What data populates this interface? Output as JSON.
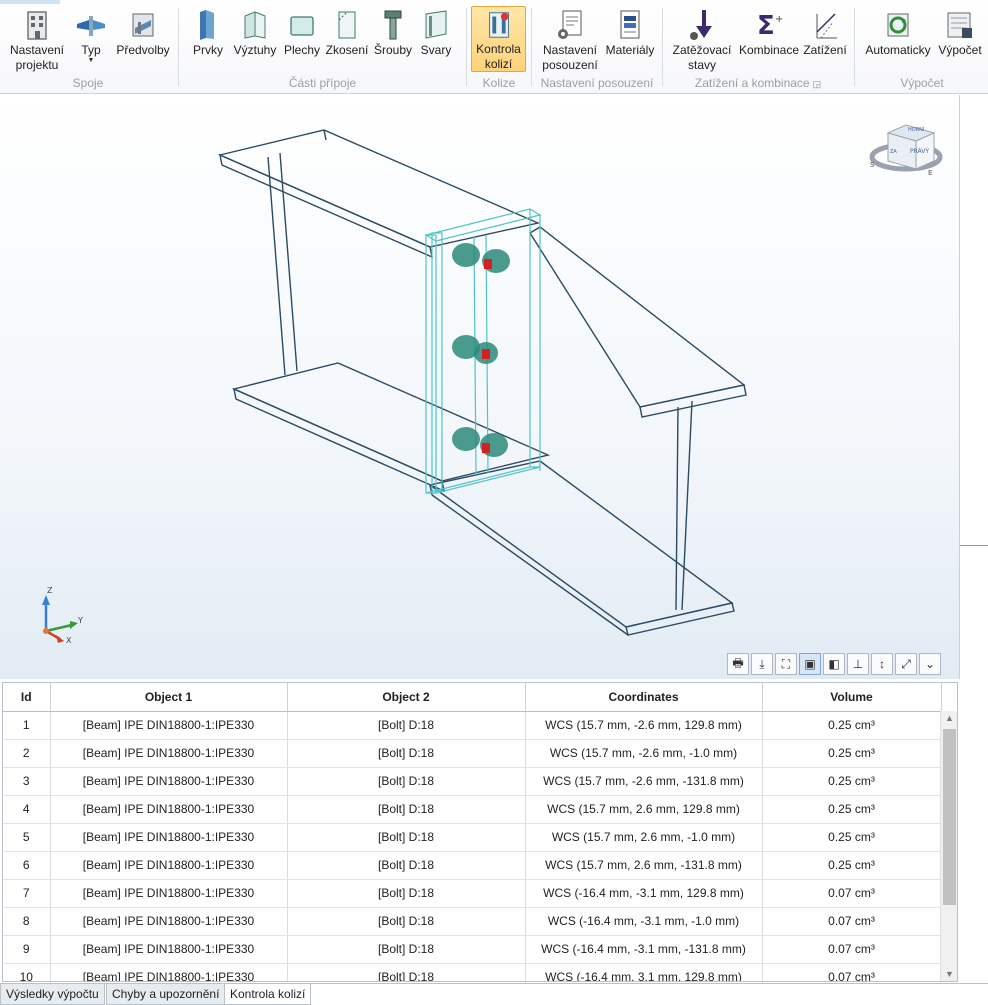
{
  "ribbon": {
    "groups": {
      "spoje": "Spoje",
      "casti": "Části přípoje",
      "kolize": "Kolize",
      "nastaveni": "Nastavení posouzení",
      "zatizeni": "Zatížení a kombinace",
      "vypocet": "Výpočet"
    },
    "buttons": {
      "nastaveni_projektu": [
        "Nastavení",
        "projektu"
      ],
      "typ": "Typ",
      "predvolby": "Předvolby",
      "prvky": "Prvky",
      "vyztuhy": "Výztuhy",
      "plechy": "Plechy",
      "zkoseni": "Zkosení",
      "srouby": "Šrouby",
      "svary": "Svary",
      "kontrola_kolizi": [
        "Kontrola",
        "kolizí"
      ],
      "nastaveni_posouzeni": [
        "Nastavení",
        "posouzení"
      ],
      "materialy": "Materiály",
      "zatezovaci_stavy": [
        "Zatěžovací",
        "stavy"
      ],
      "kombinace": "Kombinace",
      "zatizeni": "Zatížení",
      "automaticky": "Automaticky",
      "vypocet": "Výpočet"
    }
  },
  "viewport": {
    "axis_labels": {
      "z": "Z",
      "y": "Y",
      "x": "X"
    },
    "cube_label": "PRAVÝ",
    "cube_top": "HORNÍ",
    "cube_front": "ZA",
    "compass": {
      "s": "S",
      "e": "E"
    }
  },
  "table": {
    "columns": [
      "Id",
      "Object 1",
      "Object 2",
      "Coordinates",
      "Volume"
    ],
    "rows": [
      [
        "1",
        "[Beam] IPE  DIN18800-1:IPE330",
        "[Bolt] D:18",
        "WCS (15.7 mm, -2.6 mm, 129.8 mm)",
        "0.25 cm³"
      ],
      [
        "2",
        "[Beam] IPE  DIN18800-1:IPE330",
        "[Bolt] D:18",
        "WCS (15.7 mm, -2.6 mm, -1.0 mm)",
        "0.25 cm³"
      ],
      [
        "3",
        "[Beam] IPE  DIN18800-1:IPE330",
        "[Bolt] D:18",
        "WCS (15.7 mm, -2.6 mm, -131.8 mm)",
        "0.25 cm³"
      ],
      [
        "4",
        "[Beam] IPE  DIN18800-1:IPE330",
        "[Bolt] D:18",
        "WCS (15.7 mm, 2.6 mm, 129.8 mm)",
        "0.25 cm³"
      ],
      [
        "5",
        "[Beam] IPE  DIN18800-1:IPE330",
        "[Bolt] D:18",
        "WCS (15.7 mm, 2.6 mm, -1.0 mm)",
        "0.25 cm³"
      ],
      [
        "6",
        "[Beam] IPE  DIN18800-1:IPE330",
        "[Bolt] D:18",
        "WCS (15.7 mm, 2.6 mm, -131.8 mm)",
        "0.25 cm³"
      ],
      [
        "7",
        "[Beam] IPE  DIN18800-1:IPE330",
        "[Bolt] D:18",
        "WCS (-16.4 mm, -3.1 mm, 129.8 mm)",
        "0.07 cm³"
      ],
      [
        "8",
        "[Beam] IPE  DIN18800-1:IPE330",
        "[Bolt] D:18",
        "WCS (-16.4 mm, -3.1 mm, -1.0 mm)",
        "0.07 cm³"
      ],
      [
        "9",
        "[Beam] IPE  DIN18800-1:IPE330",
        "[Bolt] D:18",
        "WCS (-16.4 mm, -3.1 mm, -131.8 mm)",
        "0.07 cm³"
      ],
      [
        "10",
        "[Beam] IPE  DIN18800-1:IPE330",
        "[Bolt] D:18",
        "WCS (-16.4 mm, 3.1 mm, 129.8 mm)",
        "0.07 cm³"
      ]
    ]
  },
  "tabs": [
    "Výsledky výpočtu",
    "Chyby a upozornění",
    "Kontrola kolizí"
  ],
  "colors": {
    "accent_active": "#ffd27a",
    "beam_wire": "#2c4a63",
    "plate_wire": "#4fc3c8",
    "bolt": "#2b8a7a",
    "collision": "#d42020"
  }
}
